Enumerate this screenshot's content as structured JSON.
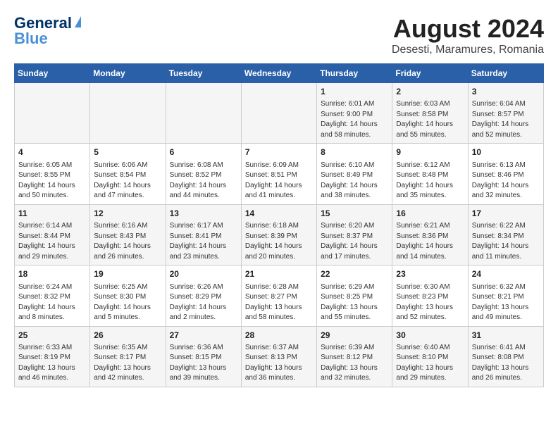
{
  "logo": {
    "line1": "General",
    "line2": "Blue"
  },
  "title": "August 2024",
  "subtitle": "Desesti, Maramures, Romania",
  "weekdays": [
    "Sunday",
    "Monday",
    "Tuesday",
    "Wednesday",
    "Thursday",
    "Friday",
    "Saturday"
  ],
  "weeks": [
    [
      {
        "day": "",
        "content": ""
      },
      {
        "day": "",
        "content": ""
      },
      {
        "day": "",
        "content": ""
      },
      {
        "day": "",
        "content": ""
      },
      {
        "day": "1",
        "content": "Sunrise: 6:01 AM\nSunset: 9:00 PM\nDaylight: 14 hours\nand 58 minutes."
      },
      {
        "day": "2",
        "content": "Sunrise: 6:03 AM\nSunset: 8:58 PM\nDaylight: 14 hours\nand 55 minutes."
      },
      {
        "day": "3",
        "content": "Sunrise: 6:04 AM\nSunset: 8:57 PM\nDaylight: 14 hours\nand 52 minutes."
      }
    ],
    [
      {
        "day": "4",
        "content": "Sunrise: 6:05 AM\nSunset: 8:55 PM\nDaylight: 14 hours\nand 50 minutes."
      },
      {
        "day": "5",
        "content": "Sunrise: 6:06 AM\nSunset: 8:54 PM\nDaylight: 14 hours\nand 47 minutes."
      },
      {
        "day": "6",
        "content": "Sunrise: 6:08 AM\nSunset: 8:52 PM\nDaylight: 14 hours\nand 44 minutes."
      },
      {
        "day": "7",
        "content": "Sunrise: 6:09 AM\nSunset: 8:51 PM\nDaylight: 14 hours\nand 41 minutes."
      },
      {
        "day": "8",
        "content": "Sunrise: 6:10 AM\nSunset: 8:49 PM\nDaylight: 14 hours\nand 38 minutes."
      },
      {
        "day": "9",
        "content": "Sunrise: 6:12 AM\nSunset: 8:48 PM\nDaylight: 14 hours\nand 35 minutes."
      },
      {
        "day": "10",
        "content": "Sunrise: 6:13 AM\nSunset: 8:46 PM\nDaylight: 14 hours\nand 32 minutes."
      }
    ],
    [
      {
        "day": "11",
        "content": "Sunrise: 6:14 AM\nSunset: 8:44 PM\nDaylight: 14 hours\nand 29 minutes."
      },
      {
        "day": "12",
        "content": "Sunrise: 6:16 AM\nSunset: 8:43 PM\nDaylight: 14 hours\nand 26 minutes."
      },
      {
        "day": "13",
        "content": "Sunrise: 6:17 AM\nSunset: 8:41 PM\nDaylight: 14 hours\nand 23 minutes."
      },
      {
        "day": "14",
        "content": "Sunrise: 6:18 AM\nSunset: 8:39 PM\nDaylight: 14 hours\nand 20 minutes."
      },
      {
        "day": "15",
        "content": "Sunrise: 6:20 AM\nSunset: 8:37 PM\nDaylight: 14 hours\nand 17 minutes."
      },
      {
        "day": "16",
        "content": "Sunrise: 6:21 AM\nSunset: 8:36 PM\nDaylight: 14 hours\nand 14 minutes."
      },
      {
        "day": "17",
        "content": "Sunrise: 6:22 AM\nSunset: 8:34 PM\nDaylight: 14 hours\nand 11 minutes."
      }
    ],
    [
      {
        "day": "18",
        "content": "Sunrise: 6:24 AM\nSunset: 8:32 PM\nDaylight: 14 hours\nand 8 minutes."
      },
      {
        "day": "19",
        "content": "Sunrise: 6:25 AM\nSunset: 8:30 PM\nDaylight: 14 hours\nand 5 minutes."
      },
      {
        "day": "20",
        "content": "Sunrise: 6:26 AM\nSunset: 8:29 PM\nDaylight: 14 hours\nand 2 minutes."
      },
      {
        "day": "21",
        "content": "Sunrise: 6:28 AM\nSunset: 8:27 PM\nDaylight: 13 hours\nand 58 minutes."
      },
      {
        "day": "22",
        "content": "Sunrise: 6:29 AM\nSunset: 8:25 PM\nDaylight: 13 hours\nand 55 minutes."
      },
      {
        "day": "23",
        "content": "Sunrise: 6:30 AM\nSunset: 8:23 PM\nDaylight: 13 hours\nand 52 minutes."
      },
      {
        "day": "24",
        "content": "Sunrise: 6:32 AM\nSunset: 8:21 PM\nDaylight: 13 hours\nand 49 minutes."
      }
    ],
    [
      {
        "day": "25",
        "content": "Sunrise: 6:33 AM\nSunset: 8:19 PM\nDaylight: 13 hours\nand 46 minutes."
      },
      {
        "day": "26",
        "content": "Sunrise: 6:35 AM\nSunset: 8:17 PM\nDaylight: 13 hours\nand 42 minutes."
      },
      {
        "day": "27",
        "content": "Sunrise: 6:36 AM\nSunset: 8:15 PM\nDaylight: 13 hours\nand 39 minutes."
      },
      {
        "day": "28",
        "content": "Sunrise: 6:37 AM\nSunset: 8:13 PM\nDaylight: 13 hours\nand 36 minutes."
      },
      {
        "day": "29",
        "content": "Sunrise: 6:39 AM\nSunset: 8:12 PM\nDaylight: 13 hours\nand 32 minutes."
      },
      {
        "day": "30",
        "content": "Sunrise: 6:40 AM\nSunset: 8:10 PM\nDaylight: 13 hours\nand 29 minutes."
      },
      {
        "day": "31",
        "content": "Sunrise: 6:41 AM\nSunset: 8:08 PM\nDaylight: 13 hours\nand 26 minutes."
      }
    ]
  ]
}
